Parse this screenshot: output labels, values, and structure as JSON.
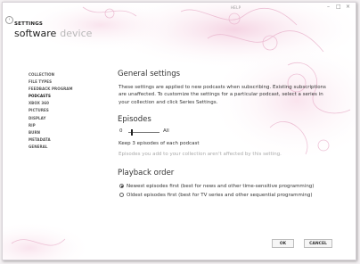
{
  "window": {
    "help_label": "HELP",
    "minimize": "–",
    "maximize": "□",
    "close": "×"
  },
  "header": {
    "title": "SETTINGS",
    "pivot_selected": "software",
    "pivot_other": "device"
  },
  "sidebar": {
    "items": [
      {
        "label": "COLLECTION"
      },
      {
        "label": "FILE TYPES"
      },
      {
        "label": "FEEDBACK PROGRAM"
      },
      {
        "label": "PODCASTS",
        "active": true
      },
      {
        "label": "XBOX 360"
      },
      {
        "label": "PICTURES"
      },
      {
        "label": "DISPLAY"
      },
      {
        "label": "RIP"
      },
      {
        "label": "BURN"
      },
      {
        "label": "METADATA"
      },
      {
        "label": "GENERAL"
      }
    ]
  },
  "general": {
    "heading": "General settings",
    "lines": [
      "These settings are applied to new podcasts when subscribing. Existing subscriptions",
      "are unaffected. To customize the settings for a particular podcast, select a series in",
      "your collection and click Series Settings."
    ]
  },
  "episodes": {
    "heading": "Episodes",
    "slider_min": "0",
    "slider_max": "All",
    "slider_value": 3,
    "keep_text": "Keep 3 episodes of each podcast",
    "note": "Episodes you add to your collection aren't affected by this setting."
  },
  "playback": {
    "heading": "Playback order",
    "options": [
      {
        "label": "Newest episodes first (best for news and other time-sensitive programming)",
        "selected": true
      },
      {
        "label": "Oldest episodes first (best for TV series and other sequential programming)",
        "selected": false
      }
    ]
  },
  "buttons": {
    "ok": "OK",
    "cancel": "CANCEL"
  }
}
